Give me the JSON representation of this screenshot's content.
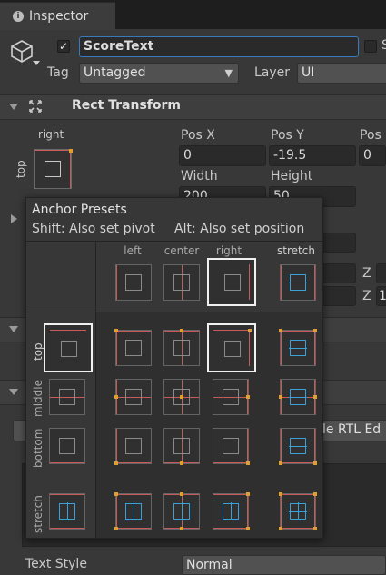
{
  "window": {
    "tab_label": "Inspector"
  },
  "header": {
    "object_name": "ScoreText",
    "tag_label": "Tag",
    "tag_value": "Untagged",
    "layer_label": "Layer",
    "layer_value": "UI",
    "static_label": "S"
  },
  "rect_transform": {
    "title": "Rect Transform",
    "anchor_box_label": "right",
    "anchor_side_label": "top",
    "fields": [
      {
        "label": "Pos X",
        "value": "0"
      },
      {
        "label": "Pos Y",
        "value": "-19.5"
      },
      {
        "label": "Pos",
        "value": "0"
      },
      {
        "label": "Width",
        "value": "200"
      },
      {
        "label": "Height",
        "value": "50"
      }
    ],
    "z_label_1": "Z",
    "z_label_2": "Z",
    "z_value_2": "1"
  },
  "background": {
    "rtl_text": "le RTL Ed",
    "text_style_label": "Text Style",
    "text_style_value": "Normal"
  },
  "anchor_presets": {
    "title": "Anchor Presets",
    "hint_pivot": "Shift: Also set pivot",
    "hint_position": "Alt: Also set position",
    "columns": [
      "left",
      "center",
      "right",
      "stretch"
    ],
    "rows": [
      "top",
      "middle",
      "bottom",
      "stretch"
    ],
    "selected_column": "right",
    "selected_row": "top"
  }
}
